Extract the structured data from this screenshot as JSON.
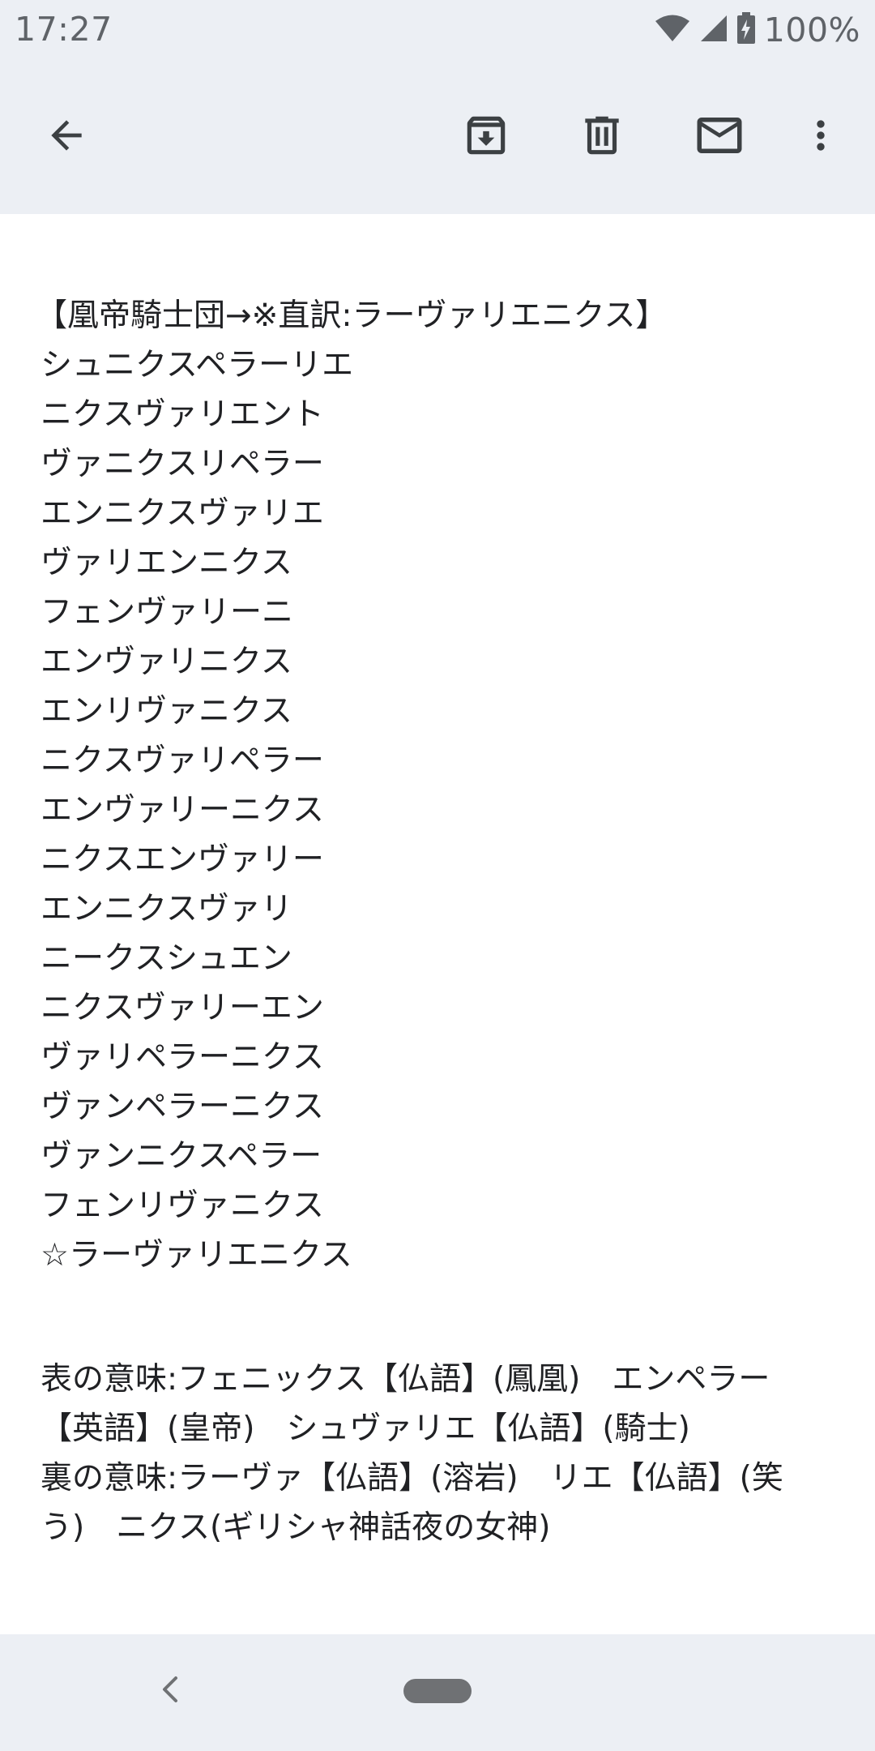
{
  "status_bar": {
    "time": "17:27",
    "battery_percent": "100%",
    "icons": [
      "wifi-icon",
      "signal-icon",
      "battery-charging-icon"
    ]
  },
  "toolbar": {
    "icons": [
      "back-arrow-icon",
      "archive-icon",
      "delete-icon",
      "mail-icon",
      "more-vert-icon"
    ]
  },
  "email": {
    "heading": "【凰帝騎士団→※直訳:ラーヴァリエニクス】",
    "names": [
      "シュニクスペラーリエ",
      "ニクスヴァリエント",
      "ヴァニクスリペラー",
      "エンニクスヴァリエ",
      "ヴァリエンニクス",
      "フェンヴァリーニ",
      "エンヴァリニクス",
      "エンリヴァニクス",
      "ニクスヴァリペラー",
      "エンヴァリーニクス",
      "ニクスエンヴァリー",
      "エンニクスヴァリ",
      "ニークスシュエン",
      "ニクスヴァリーエン",
      "ヴァリペラーニクス",
      "ヴァンペラーニクス",
      "ヴァンニクスペラー",
      "フェンリヴァニクス",
      "☆ラーヴァリエニクス"
    ],
    "notes": [
      "表の意味:フェニックス【仏語】(鳳凰)　エンペラー",
      "【英語】(皇帝)　シュヴァリエ【仏語】(騎士)",
      "裏の意味:ラーヴァ【仏語】(溶岩)　リエ【仏語】(笑",
      "う)　ニクス(ギリシャ神話夜の女神)"
    ]
  },
  "nav_bar": {
    "icons": [
      "nav-back-icon",
      "home-pill-icon"
    ]
  }
}
